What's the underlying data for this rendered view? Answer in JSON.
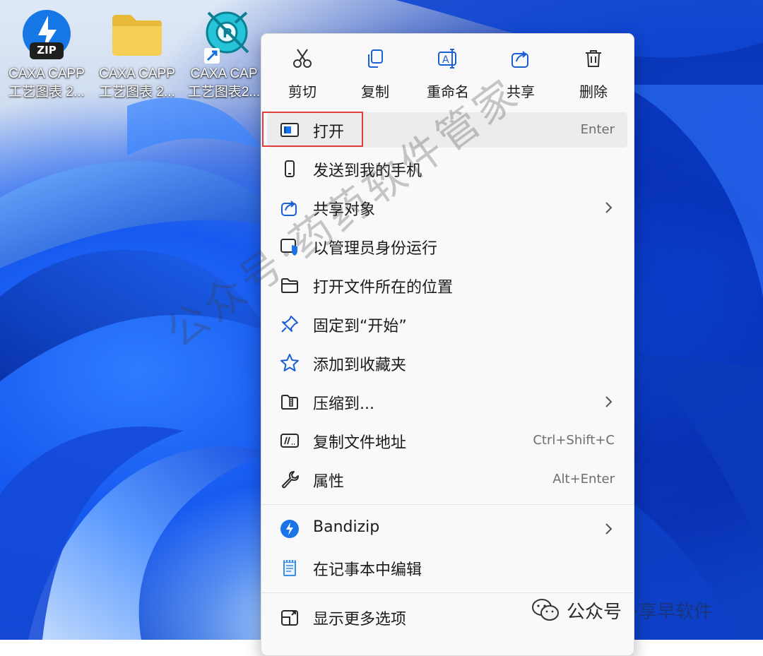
{
  "desktop": {
    "icons": [
      {
        "label_line1": "CAXA CAPP",
        "label_line2": "工艺图表 2...",
        "badge": "ZIP"
      },
      {
        "label_line1": "CAXA CAPP",
        "label_line2": "工艺图表 2..."
      },
      {
        "label_line1": "CAXA CAP",
        "label_line2": "工艺图表2..."
      }
    ]
  },
  "context_menu": {
    "toolbar": [
      {
        "label": "剪切",
        "icon": "scissors-icon"
      },
      {
        "label": "复制",
        "icon": "copy-icon"
      },
      {
        "label": "重命名",
        "icon": "rename-icon"
      },
      {
        "label": "共享",
        "icon": "share-icon"
      },
      {
        "label": "删除",
        "icon": "trash-icon"
      }
    ],
    "items": [
      {
        "label": "打开",
        "shortcut": "Enter",
        "icon": "open-app-icon"
      },
      {
        "label": "发送到我的手机",
        "icon": "phone-icon"
      },
      {
        "label": "共享对象",
        "icon": "share-icon"
      },
      {
        "label": "以管理员身份运行",
        "icon": "shield-icon"
      },
      {
        "label": "打开文件所在的位置",
        "icon": "folder-icon"
      },
      {
        "label": "固定到“开始”",
        "icon": "pin-icon"
      },
      {
        "label": "添加到收藏夹",
        "icon": "star-icon"
      },
      {
        "label": "压缩到...",
        "icon": "zip-folder-icon"
      },
      {
        "label": "复制文件地址",
        "shortcut": "Ctrl+Shift+C",
        "icon": "copy-path-icon"
      },
      {
        "label": "属性",
        "shortcut": "Alt+Enter",
        "icon": "wrench-icon"
      },
      {
        "label": "Bandizip",
        "icon": "bandizip-icon"
      },
      {
        "label": "在记事本中编辑",
        "icon": "notepad-icon"
      },
      {
        "label": "显示更多选项",
        "icon": "more-options-icon"
      }
    ]
  },
  "watermark": {
    "diagonal": "公众号·药药软件管家",
    "bottom_prefix": "公众号",
    "bottom_suffix": "·享早软件"
  },
  "colors": {
    "accent": "#1a73e8",
    "highlight_border": "#e23c3c",
    "menu_bg": "#f9f9f9"
  }
}
